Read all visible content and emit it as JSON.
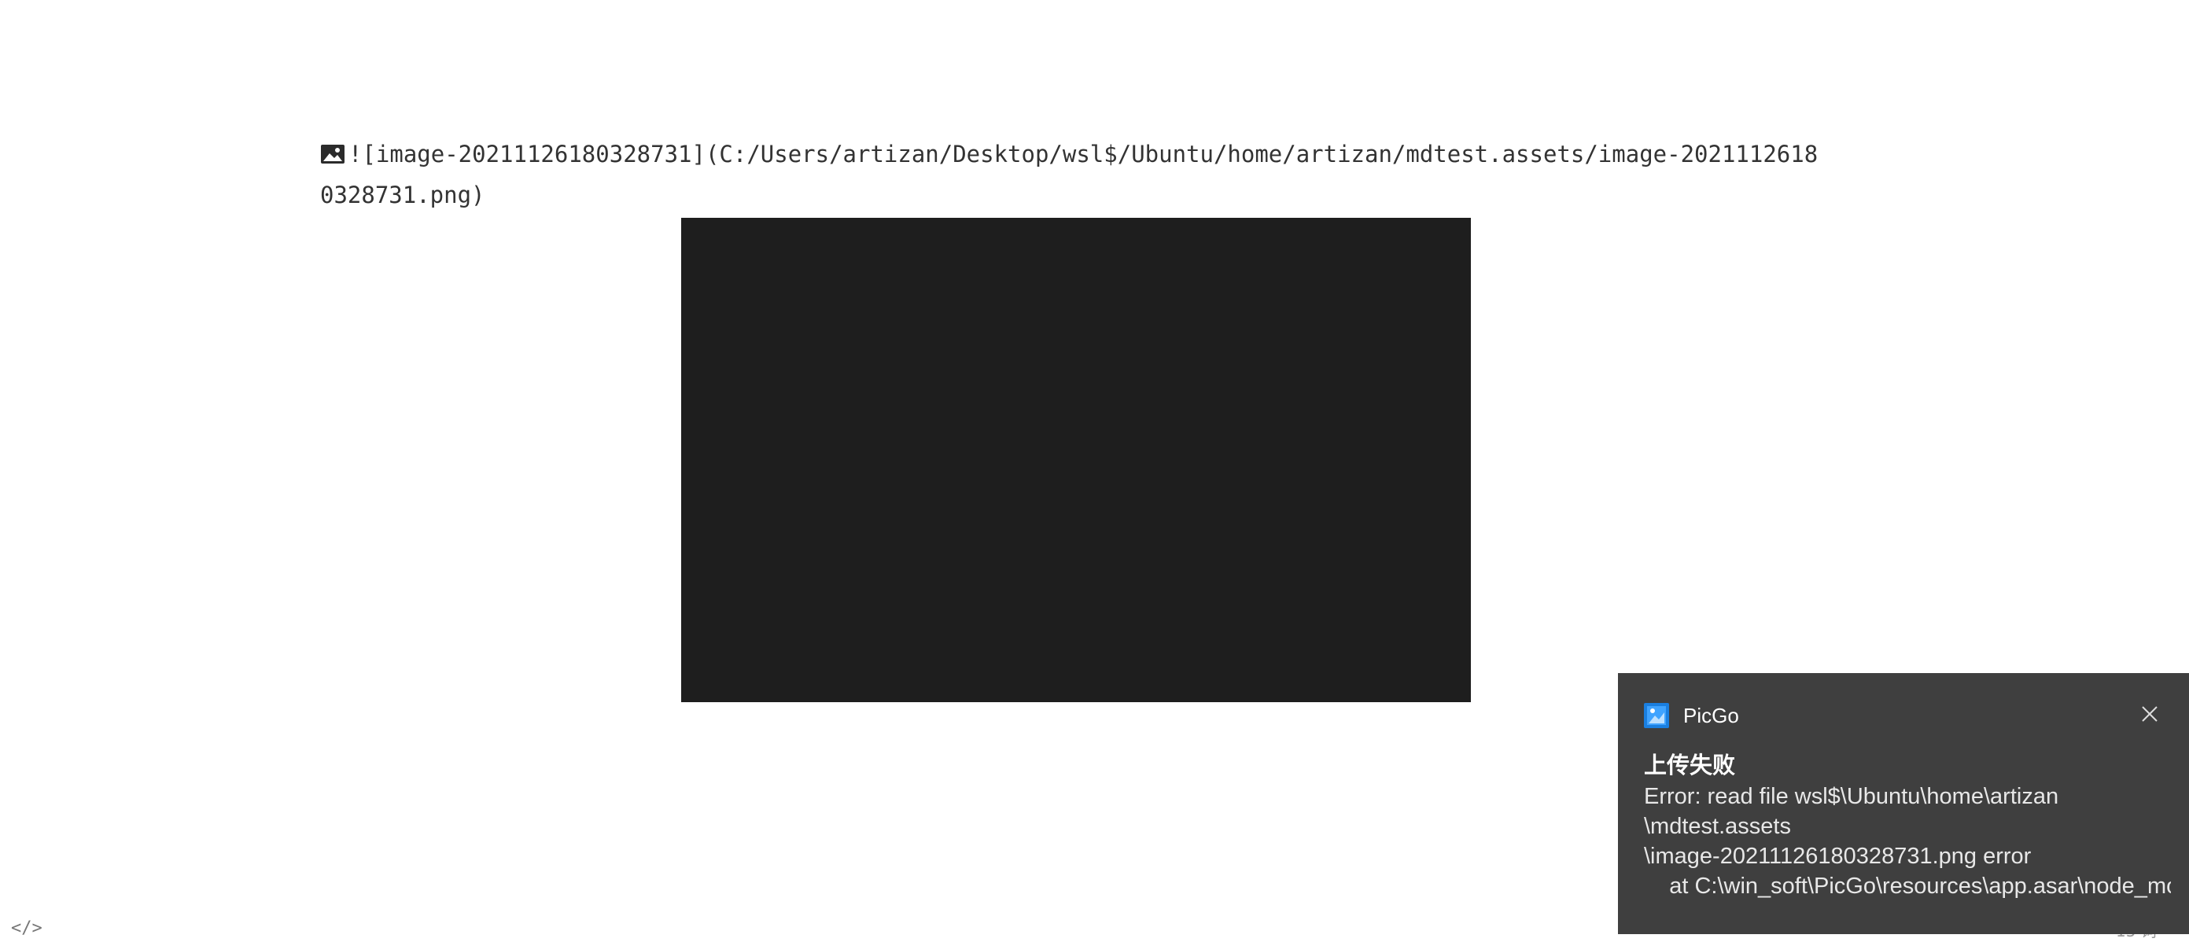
{
  "editor": {
    "markdown_source": "![image-20211126180328731](C:/Users/artizan/Desktop/wsl$/Ubuntu/home/artizan/mdtest.assets/image-20211126180328731.png)",
    "broken_image_icon": "image-icon",
    "source_toggle_label": "</>",
    "word_count": "15 词"
  },
  "notification": {
    "app_name": "PicGo",
    "app_icon": "picgo-logo-icon",
    "close_icon": "close-icon",
    "title": "上传失败",
    "body_lines": [
      "Error: read file wsl$\\Ubuntu\\home\\artizan",
      "\\mdtest.assets",
      "\\image-20211126180328731.png error",
      "    at C:\\win_soft\\PicGo\\resources\\app.asar\\node_modules"
    ]
  }
}
